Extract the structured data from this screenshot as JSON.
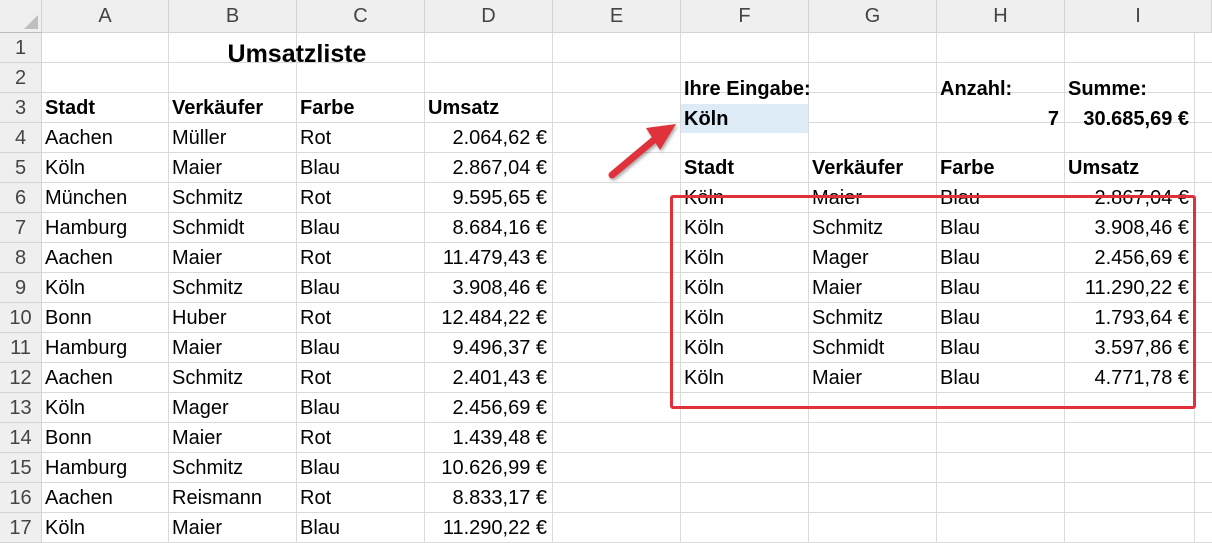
{
  "columns": [
    "A",
    "B",
    "C",
    "D",
    "E",
    "F",
    "G",
    "H",
    "I"
  ],
  "rows": [
    "1",
    "2",
    "3",
    "4",
    "5",
    "6",
    "7",
    "8",
    "9",
    "10",
    "11",
    "12",
    "13",
    "14",
    "15",
    "16",
    "17"
  ],
  "title": "Umsatzliste",
  "left_table": {
    "headers": [
      "Stadt",
      "Verkäufer",
      "Farbe",
      "Umsatz"
    ],
    "rows": [
      [
        "Aachen",
        "Müller",
        "Rot",
        "2.064,62 €"
      ],
      [
        "Köln",
        "Maier",
        "Blau",
        "2.867,04 €"
      ],
      [
        "München",
        "Schmitz",
        "Rot",
        "9.595,65 €"
      ],
      [
        "Hamburg",
        "Schmidt",
        "Blau",
        "8.684,16 €"
      ],
      [
        "Aachen",
        "Maier",
        "Rot",
        "11.479,43 €"
      ],
      [
        "Köln",
        "Schmitz",
        "Blau",
        "3.908,46 €"
      ],
      [
        "Bonn",
        "Huber",
        "Rot",
        "12.484,22 €"
      ],
      [
        "Hamburg",
        "Maier",
        "Blau",
        "9.496,37 €"
      ],
      [
        "Aachen",
        "Schmitz",
        "Rot",
        "2.401,43 €"
      ],
      [
        "Köln",
        "Mager",
        "Blau",
        "2.456,69 €"
      ],
      [
        "Bonn",
        "Maier",
        "Rot",
        "1.439,48 €"
      ],
      [
        "Hamburg",
        "Schmitz",
        "Blau",
        "10.626,99 €"
      ],
      [
        "Aachen",
        "Reismann",
        "Rot",
        "8.833,17 €"
      ],
      [
        "Köln",
        "Maier",
        "Blau",
        "11.290,22 €"
      ]
    ]
  },
  "query": {
    "input_label": "Ihre Eingabe:",
    "input_value": "Köln",
    "count_label": "Anzahl:",
    "count_value": "7",
    "sum_label": "Summe:",
    "sum_value": "30.685,69 €"
  },
  "result_table": {
    "headers": [
      "Stadt",
      "Verkäufer",
      "Farbe",
      "Umsatz"
    ],
    "rows": [
      [
        "Köln",
        "Maier",
        "Blau",
        "2.867,04 €"
      ],
      [
        "Köln",
        "Schmitz",
        "Blau",
        "3.908,46 €"
      ],
      [
        "Köln",
        "Mager",
        "Blau",
        "2.456,69 €"
      ],
      [
        "Köln",
        "Maier",
        "Blau",
        "11.290,22 €"
      ],
      [
        "Köln",
        "Schmitz",
        "Blau",
        "1.793,64 €"
      ],
      [
        "Köln",
        "Schmidt",
        "Blau",
        "3.597,86 €"
      ],
      [
        "Köln",
        "Maier",
        "Blau",
        "4.771,78 €"
      ]
    ]
  },
  "colors": {
    "input_fill": "#ddebf7",
    "highlight_red": "#e0303a"
  }
}
